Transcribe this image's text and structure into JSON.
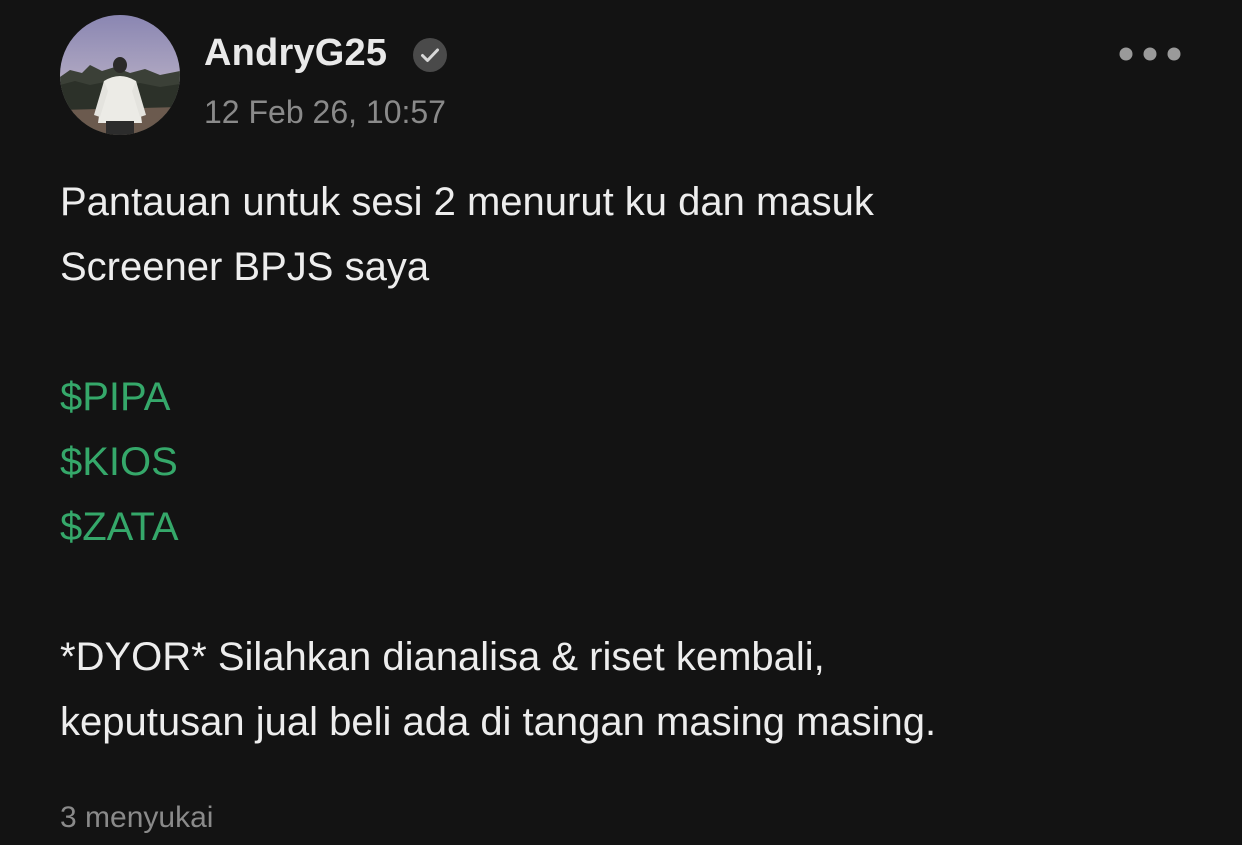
{
  "post": {
    "author": {
      "name": "AndryG25",
      "verified_icon": "verified-check-icon",
      "avatar_icon": "avatar-photo"
    },
    "timestamp": "12 Feb 26, 10:57",
    "more_icon": "more-dots-icon",
    "body": {
      "intro_lines": [
        "Pantauan untuk sesi 2 menurut ku dan masuk",
        "Screener BPJS saya"
      ],
      "tickers": [
        "$PIPA",
        "$KIOS",
        "$ZATA"
      ],
      "disclaimer_lines": [
        "*DYOR* Silahkan dianalisa & riset kembali,",
        "keputusan jual beli ada di tangan masing masing."
      ]
    },
    "likes": "3 menyukai"
  },
  "colors": {
    "background": "#131313",
    "text": "#ededed",
    "muted": "#8a8a8a",
    "ticker": "#35a86a"
  }
}
